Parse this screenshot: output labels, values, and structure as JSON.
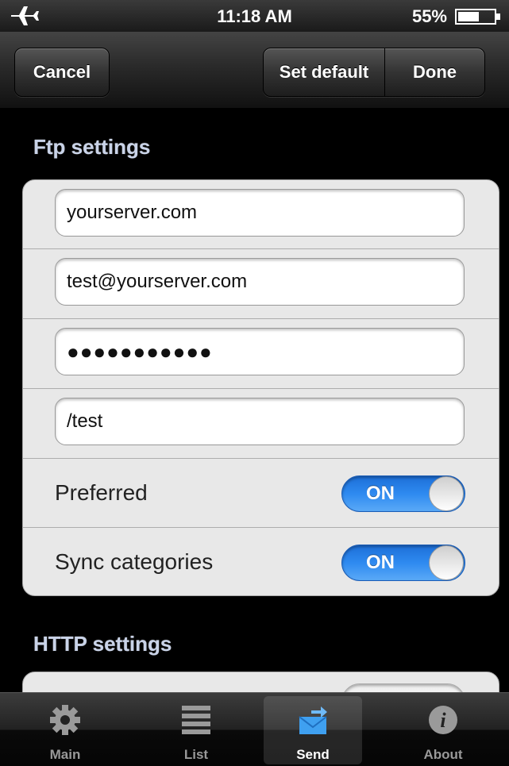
{
  "status_bar": {
    "time": "11:18 AM",
    "battery": "55%"
  },
  "nav": {
    "cancel": "Cancel",
    "set_default": "Set default",
    "done": "Done"
  },
  "ftp": {
    "title": "Ftp settings",
    "server": "yourserver.com",
    "user": "test@yourserver.com",
    "password_mask": "●●●●●●●●●●●",
    "path": "/test",
    "preferred": {
      "label": "Preferred",
      "state": "ON"
    },
    "sync": {
      "label": "Sync categories",
      "state": "ON"
    }
  },
  "http": {
    "title": "HTTP settings"
  },
  "tabs": [
    {
      "label": "Main",
      "icon": "gear-icon"
    },
    {
      "label": "List",
      "icon": "list-icon"
    },
    {
      "label": "Send",
      "icon": "send-mail-icon",
      "active": true
    },
    {
      "label": "About",
      "icon": "info-icon"
    }
  ]
}
